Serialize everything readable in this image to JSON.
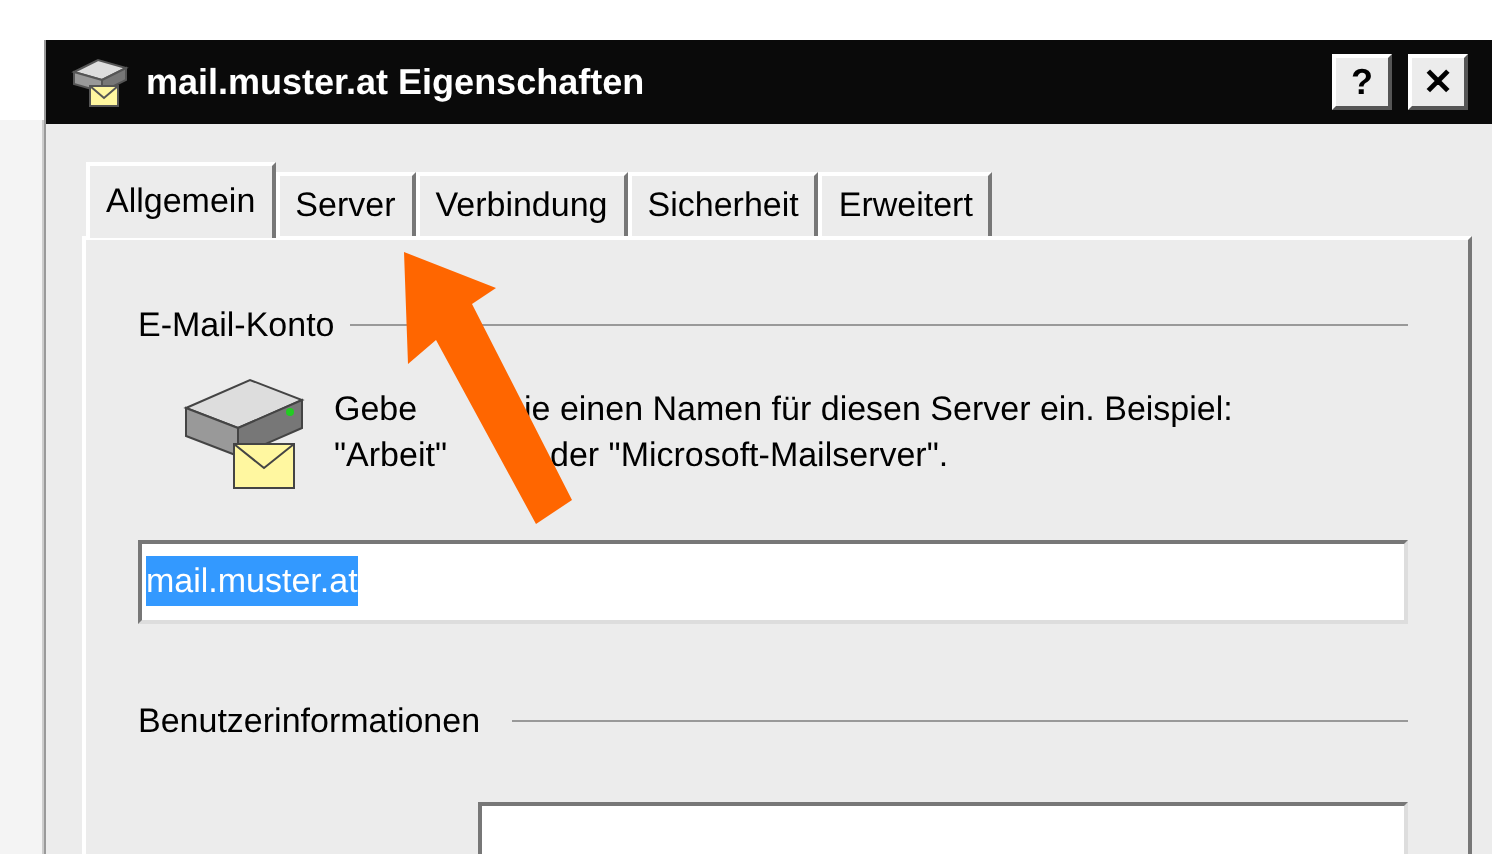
{
  "window": {
    "title": "mail.muster.at Eigenschaften",
    "help_button": "?",
    "close_button": "✕"
  },
  "tabs": [
    {
      "label": "Allgemein",
      "selected": true
    },
    {
      "label": "Server",
      "selected": false
    },
    {
      "label": "Verbindung",
      "selected": false
    },
    {
      "label": "Sicherheit",
      "selected": false
    },
    {
      "label": "Erweitert",
      "selected": false
    }
  ],
  "email_account": {
    "heading": "E-Mail-Konto",
    "description_lines": [
      [
        "Gebe",
        "ie einen Namen für diesen Server ein. Beispiel:"
      ],
      [
        "\"Arbeit\"",
        "der \"Microsoft-Mailserver\"."
      ]
    ],
    "account_name": {
      "value": "mail.muster.at",
      "selected": true
    }
  },
  "user_info": {
    "heading": "Benutzerinformationen"
  }
}
